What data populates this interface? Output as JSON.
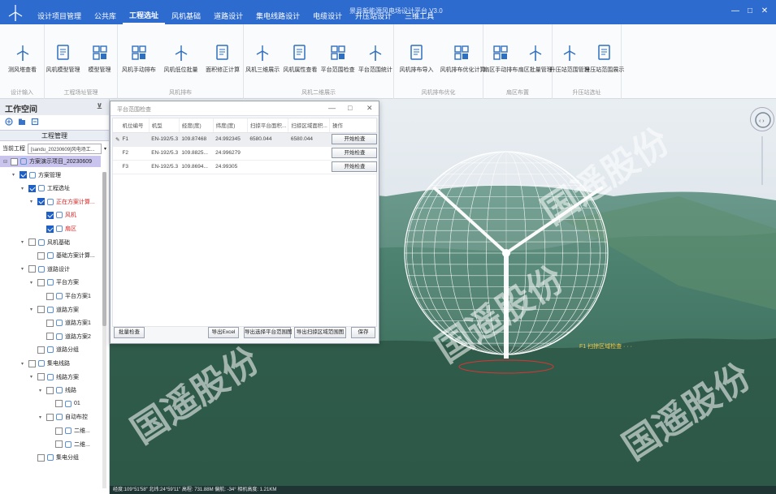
{
  "window": {
    "title": "景县新能源风电场设计平台 V3.0",
    "minimize": "—",
    "maximize": "□",
    "close": "✕"
  },
  "menus": [
    "设计项目管理",
    "公共库",
    "工程选址",
    "风机基础",
    "道路设计",
    "集电线路设计",
    "电缆设计",
    "升压站设计",
    "三维工具"
  ],
  "active_menu": "工程选址",
  "ribbon": {
    "groups": [
      {
        "name": "设计输入",
        "buttons": [
          "测风塔查看"
        ]
      },
      {
        "name": "工程场址管理",
        "buttons": [
          "风机模型管理",
          "模型管理"
        ]
      },
      {
        "name": "风机排布",
        "buttons": [
          "风机手动排布",
          "风机低位批量",
          "面积修正计算"
        ]
      },
      {
        "name": "风机二维展示",
        "buttons": [
          "风机三维展示",
          "风机属性查看",
          "平台范围检查",
          "平台范围统计"
        ]
      },
      {
        "name": "风机排布优化",
        "buttons": [
          "风机排布导入",
          "风机排布优化计算"
        ]
      },
      {
        "name": "扇区布置",
        "buttons": [
          "扇区手动排布",
          "扇区批量管理"
        ]
      },
      {
        "name": "升压站选址",
        "buttons": [
          "升压站范围管理",
          "升压站范围展示"
        ]
      }
    ]
  },
  "workspace": {
    "title": "工作空间",
    "pin": "⊻",
    "mgmt_label": "工程管理",
    "project_label": "当前工程",
    "project_value": "[sandu_20230609]风电场工...",
    "tree": [
      {
        "label": "方案演示项目_20230609",
        "indent": 0,
        "check": false,
        "hl": true,
        "tri": "⊟"
      },
      {
        "label": "方案管理",
        "indent": 1,
        "check": true,
        "tri": "▾"
      },
      {
        "label": "工程选址",
        "indent": 2,
        "check": true,
        "tri": "▾"
      },
      {
        "label": "正在方案计算...",
        "indent": 3,
        "check": true,
        "tri": "▾",
        "red": true
      },
      {
        "label": "风机",
        "indent": 4,
        "check": true,
        "red": true
      },
      {
        "label": "扇区",
        "indent": 4,
        "check": true,
        "red": true
      },
      {
        "label": "风机基础",
        "indent": 2,
        "check": false,
        "tri": "▾"
      },
      {
        "label": "基础方案计算...",
        "indent": 3,
        "check": false
      },
      {
        "label": "道路设计",
        "indent": 2,
        "check": false,
        "tri": "▾"
      },
      {
        "label": "平台方案",
        "indent": 3,
        "check": false,
        "tri": "▾"
      },
      {
        "label": "平台方案1",
        "indent": 4,
        "check": false
      },
      {
        "label": "道路方案",
        "indent": 3,
        "check": false,
        "tri": "▾"
      },
      {
        "label": "道路方案1",
        "indent": 4,
        "check": false
      },
      {
        "label": "道路方案2",
        "indent": 4,
        "check": false
      },
      {
        "label": "道路分组",
        "indent": 3,
        "check": false
      },
      {
        "label": "集电线路",
        "indent": 2,
        "check": false,
        "tri": "▾"
      },
      {
        "label": "线路方案",
        "indent": 3,
        "check": false,
        "tri": "▾"
      },
      {
        "label": "线路",
        "indent": 4,
        "check": false,
        "tri": "▾"
      },
      {
        "label": "01",
        "indent": 5,
        "check": false
      },
      {
        "label": "自动布控",
        "indent": 4,
        "check": false,
        "tri": "▾"
      },
      {
        "label": "二维...",
        "indent": 5,
        "check": false
      },
      {
        "label": "二维...",
        "indent": 5,
        "check": false
      },
      {
        "label": "集电分组",
        "indent": 3,
        "check": false
      }
    ]
  },
  "dialog": {
    "title": "平台范围检查",
    "columns": [
      "机位编号",
      "机型",
      "经度(度)",
      "纬度(度)",
      "扫掠平台面积...",
      "扫掠区域面积...",
      "操作"
    ],
    "rows": [
      {
        "id": "F1",
        "model": "EN-192/5.3",
        "lon": "109.87468",
        "lat": "24.992345",
        "area1": "6580.044",
        "area2": "6580.044",
        "action": "开始检查"
      },
      {
        "id": "F2",
        "model": "EN-192/5.3",
        "lon": "109.8825...",
        "lat": "24.996279",
        "area1": "",
        "area2": "",
        "action": "开始检查"
      },
      {
        "id": "F3",
        "model": "EN-192/5.3",
        "lon": "109.8694...",
        "lat": "24.99305",
        "area1": "",
        "area2": "",
        "action": "开始检查"
      }
    ],
    "footer": {
      "batch": "批量检查",
      "export_excel": "导出Excel",
      "export_range": "导出选择平台范围图",
      "export_sweep": "导出扫掠区域范围图",
      "save": "保存"
    }
  },
  "view": {
    "status": "经度:109°51′58″  北纬:24°59′11″  高程: 731.88M  偏航: -34°  相机高度: 1.21KM",
    "label": "F1 扫掠区域检查  ·  ·  ·",
    "watermark": "国遥股份"
  },
  "colors": {
    "titlebar": "#2e6bcf",
    "accent": "#1e5fc8",
    "highlight_row": "#c9c4ee",
    "alert_text": "#dd2222"
  }
}
